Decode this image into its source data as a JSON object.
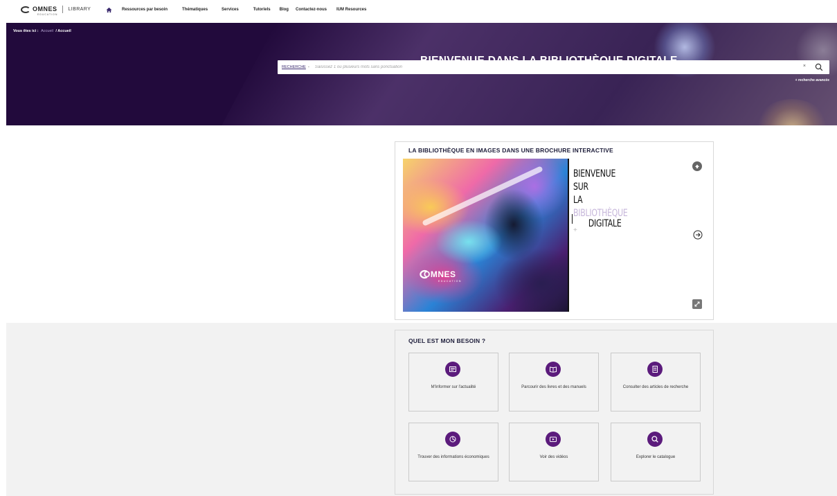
{
  "logo": {
    "name": "OMNES",
    "sub": "EDUCATION",
    "library": "LIBRARY"
  },
  "nav": {
    "items": [
      "Ressources par besoin",
      "Thématiques",
      "Services",
      "Tutoriels",
      "Blog",
      "Contactez-nous",
      "IUM Resources"
    ]
  },
  "hero": {
    "breadcrumb_label": "Vous êtes ici :",
    "breadcrumb_link": "Accueil",
    "breadcrumb_current": "/ Accueil",
    "title": "BIENVENUE DANS LA BIBLIOTHÈQUE DIGITALE"
  },
  "search": {
    "type": "RECHERCHE",
    "dash": "-",
    "placeholder": "Saisissez 1 ou plusieurs mots sans ponctuation",
    "clear": "×",
    "advanced": "+ recherche avancée"
  },
  "brochure": {
    "title": "LA BIBLIOTHÈQUE EN IMAGES DANS UNE BROCHURE INTERACTIVE",
    "line1": "BIENVENUE",
    "line2": "SUR",
    "line3": "LA",
    "line4": "BIBLIOTHÈQUE",
    "line5": "DIGITALE",
    "plus": "+",
    "logo_name": "OMNES",
    "logo_sub": "EDUCATION"
  },
  "needs": {
    "title": "QUEL EST MON BESOIN ?",
    "cards": [
      {
        "label": "M'informer sur l'actualité",
        "icon": "newspaper-icon"
      },
      {
        "label": "Parcourir des livres et des manuels",
        "icon": "book-icon"
      },
      {
        "label": "Consulter des articles de recherche",
        "icon": "document-icon"
      },
      {
        "label": "Trouver des informations économiques",
        "icon": "chart-pie-icon"
      },
      {
        "label": "Voir des vidéos",
        "icon": "video-icon"
      },
      {
        "label": "Explorer le catalogue",
        "icon": "search-icon"
      }
    ]
  },
  "colors": {
    "hero_bg": "#220a3c",
    "accent": "#5b1b7c",
    "section_bg": "#f2f2f2"
  }
}
